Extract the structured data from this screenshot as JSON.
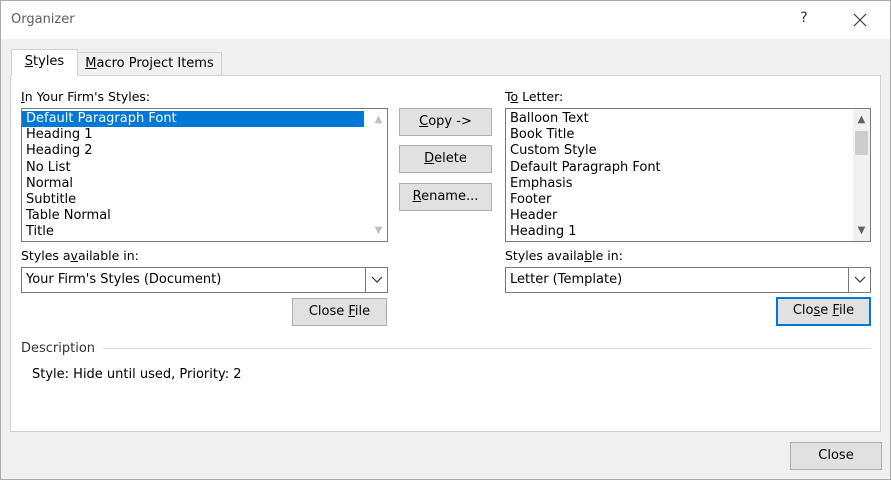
{
  "window": {
    "title": "Organizer",
    "help_label": "?",
    "close_glyph": "✕"
  },
  "tabs": [
    {
      "label": "Styles",
      "underline": "S",
      "rest": "tyles",
      "active": true
    },
    {
      "label": "Macro Project Items",
      "underline": "M",
      "rest": "acro Project Items",
      "active": false
    }
  ],
  "left": {
    "list_label_pre": "",
    "list_label_ul": "I",
    "list_label_post": "n Your Firm's Styles:",
    "items": [
      "Default Paragraph Font",
      "Heading 1",
      "Heading 2",
      "No List",
      "Normal",
      "Subtitle",
      "Table Normal",
      "Title"
    ],
    "selected_index": 0,
    "avail_pre": "Styles a",
    "avail_ul": "v",
    "avail_post": "ailable in:",
    "avail_value": "Your Firm's Styles (Document)",
    "close_file_pre": "Close ",
    "close_file_ul": "F",
    "close_file_post": "ile"
  },
  "middle": {
    "copy_ul": "C",
    "copy_post": "opy ->",
    "delete_ul": "D",
    "delete_post": "elete",
    "rename_ul": "R",
    "rename_post": "ename..."
  },
  "right": {
    "list_label_pre": "T",
    "list_label_ul": "o",
    "list_label_post": " Letter:",
    "items": [
      "Balloon Text",
      "Book Title",
      "Custom Style",
      "Default Paragraph Font",
      "Emphasis",
      "Footer",
      "Header",
      "Heading 1"
    ],
    "avail_pre": "Styles availa",
    "avail_ul": "b",
    "avail_post": "le in:",
    "avail_value": "Letter (Template)",
    "close_file_pre": "Clo",
    "close_file_ul": "s",
    "close_file_mid": "e ",
    "close_file_ul2": "F",
    "close_file_post": "ile"
  },
  "description": {
    "label": "Description",
    "text": "Style: Hide until used, Priority: 2"
  },
  "footer": {
    "close_label": "Close"
  }
}
